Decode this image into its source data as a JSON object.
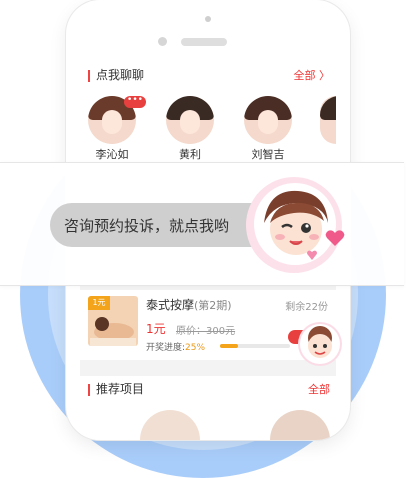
{
  "section_chat": {
    "title": "点我聊聊",
    "more": "全部 〉"
  },
  "avatars": [
    {
      "name": "李沁如",
      "badge": "•••",
      "hair": "#6a3b2a"
    },
    {
      "name": "黄利",
      "badge": "",
      "hair": "#3a2a24"
    },
    {
      "name": "刘智吉",
      "badge": "",
      "hair": "#4a2e26"
    },
    {
      "name": "",
      "badge": "",
      "hair": "#3b2a22"
    }
  ],
  "overlay": {
    "text": "咨询预约投诉，就点我哟"
  },
  "product": {
    "tag": "1元",
    "title": "泰式按摩",
    "subtitle": "(第2期)",
    "remain": "剩余22份",
    "price": "1元",
    "original_price": "原价：300元",
    "progress_label": "开奖进度:",
    "progress_value": "25%",
    "progress_fraction": 0.25
  },
  "section_recommend": {
    "title": "推荐项目",
    "more": "全部"
  },
  "colors": {
    "accent": "#e8403f",
    "orange": "#f3a41a",
    "bg_blue": "#a9cdfa"
  }
}
